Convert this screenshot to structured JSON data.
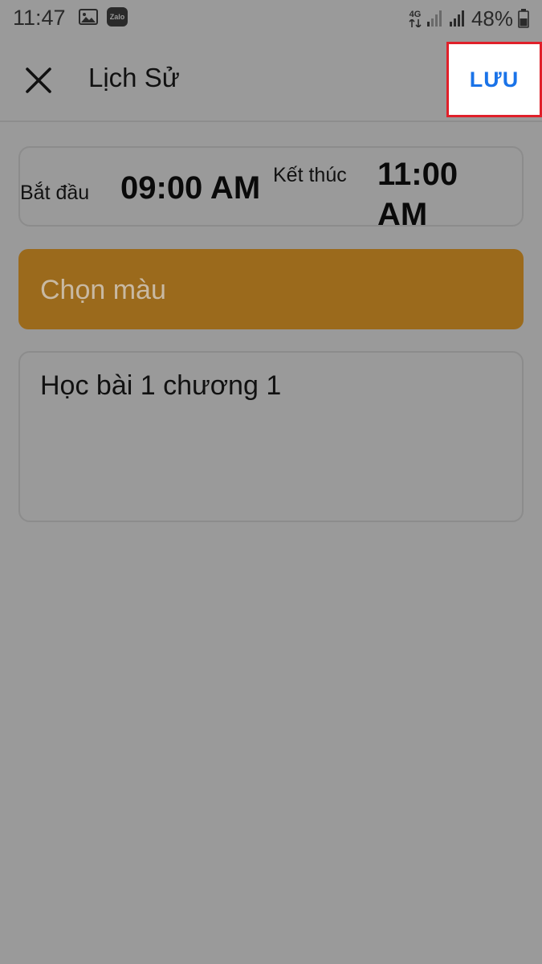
{
  "status_bar": {
    "time": "11:47",
    "zalo_label": "Zalo",
    "network": "4G",
    "battery": "48%"
  },
  "toolbar": {
    "title": "Lịch Sử",
    "save_label": "LƯU"
  },
  "schedule": {
    "start_label": "Bắt đầu",
    "start_value": "09:00 AM",
    "end_label": "Kết thúc",
    "end_value": "11:00 AM"
  },
  "color_picker": {
    "label": "Chọn màu",
    "color": "#9b6a1c"
  },
  "note": {
    "value": "Học bài 1 chương 1"
  },
  "colors": {
    "accent": "#1a73e8",
    "highlight_border": "#e0202a",
    "background": "#9a9a9a"
  }
}
